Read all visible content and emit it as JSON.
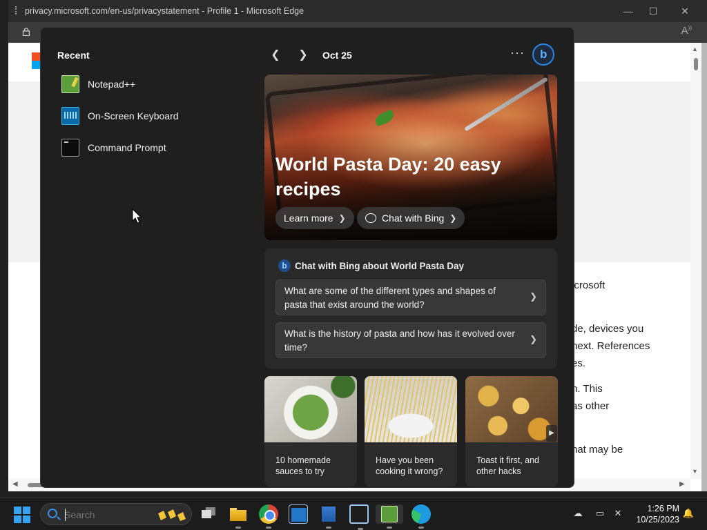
{
  "browser": {
    "title": "privacy.microsoft.com/en-us/privacystatement - Profile 1 - Microsoft Edge",
    "window_controls": {
      "minimize": "—",
      "maximize": "☐",
      "close": "✕"
    },
    "page_text_fragments": [
      "icrosoft",
      "de, devices you",
      " next. References",
      "es.",
      "n. This",
      "as other",
      "hat may be"
    ]
  },
  "start_panel": {
    "recent_title": "Recent",
    "recent_items": [
      {
        "label": "Notepad++",
        "icon": "notepad-plus-plus-icon"
      },
      {
        "label": "On-Screen Keyboard",
        "icon": "on-screen-keyboard-icon"
      },
      {
        "label": "Command Prompt",
        "icon": "command-prompt-icon"
      }
    ],
    "date": "Oct 25",
    "more_label": "···",
    "hero": {
      "headline": "World Pasta Day: 20 easy recipes",
      "learn_more": "Learn more",
      "chat_with_bing": "Chat with Bing"
    },
    "chat_card": {
      "heading": "Chat with Bing about World Pasta Day",
      "questions": [
        "What are some of the different types and shapes of pasta that exist around the world?",
        "What is the history of pasta and how has it evolved over time?"
      ]
    },
    "tiles": [
      {
        "caption": "10 homemade sauces to try"
      },
      {
        "caption": "Have you been cooking it wrong?"
      },
      {
        "caption": "Toast it first, and other hacks"
      }
    ]
  },
  "taskbar": {
    "search_placeholder": "Search",
    "clock_time": "1:26 PM",
    "clock_date": "10/25/2023",
    "pinned_apps": [
      "task-view",
      "file-explorer",
      "chrome",
      "windows-98-app",
      "virtualbox",
      "vm-cube",
      "notepad-plus-plus",
      "edge"
    ]
  },
  "colors": {
    "panel_bg": "#1f1f1f",
    "accent": "#3a8ee6",
    "taskbar_bg": "#1c1c1c"
  }
}
